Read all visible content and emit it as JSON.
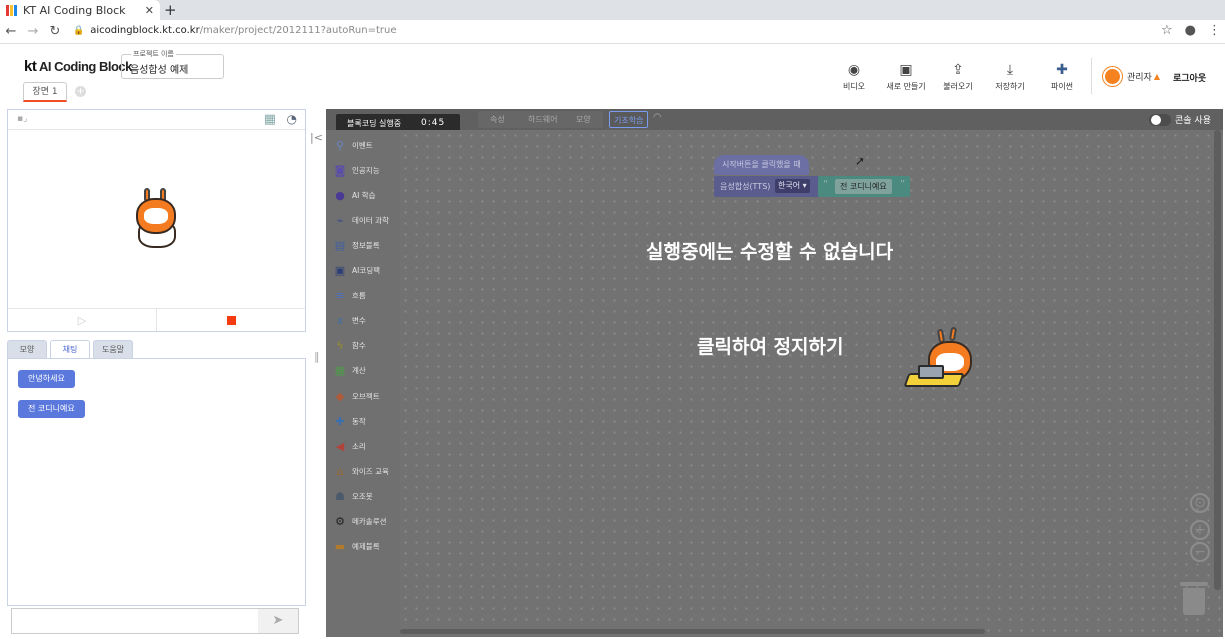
{
  "browser": {
    "tab_title": "KT AI Coding Block",
    "url_host": "aicodingblock.kt.co.kr",
    "url_path": "/maker/project/2012111?autoRun=true"
  },
  "header": {
    "logo_kt": "kt",
    "logo_text": "AI Coding Block",
    "project_label": "프로젝트 이름",
    "project_name": "음성합성 예제",
    "scene_tab": "장면 1",
    "tools": [
      {
        "label": "비디오",
        "icon": "webcam-icon"
      },
      {
        "label": "새로 만들기",
        "icon": "new-file-icon"
      },
      {
        "label": "불러오기",
        "icon": "upload-icon"
      },
      {
        "label": "저장하기",
        "icon": "download-icon"
      },
      {
        "label": "파이썬",
        "icon": "python-icon"
      }
    ],
    "user_name": "관리자",
    "logout": "로그아웃"
  },
  "left": {
    "tabs": [
      "모양",
      "채팅",
      "도움말"
    ],
    "active_tab": "채팅",
    "chat_messages": [
      "안녕하세요",
      "전 코디니예요"
    ]
  },
  "editor": {
    "tabs": [
      "속성",
      "하드웨어",
      "모양"
    ],
    "basic_tab": "기초학습",
    "run_label": "블록코딩 실행중",
    "timer": "0:45",
    "toggle_label": "콘솔 사용",
    "palette": [
      {
        "label": "이벤트",
        "icon": "event-icon",
        "color": "#6a85c8"
      },
      {
        "label": "인공지능",
        "icon": "ai-robot-icon",
        "color": "#5b4ea8"
      },
      {
        "label": "AI 학습",
        "icon": "ai-learning-icon",
        "color": "#4a3a96"
      },
      {
        "label": "데이터 과학",
        "icon": "chart-icon",
        "color": "#3c4d8f"
      },
      {
        "label": "정보블록",
        "icon": "info-block-icon",
        "color": "#3f5fa0"
      },
      {
        "label": "AI코딩팩",
        "icon": "coding-pack-icon",
        "color": "#2c3e75"
      },
      {
        "label": "흐름",
        "icon": "flow-icon",
        "color": "#4a6fc1"
      },
      {
        "label": "변수",
        "icon": "variable-icon",
        "color": "#3b6fb0"
      },
      {
        "label": "함수",
        "icon": "function-icon",
        "color": "#9b8e2a"
      },
      {
        "label": "계산",
        "icon": "calculate-icon",
        "color": "#4e9a4a"
      },
      {
        "label": "오브젝트",
        "icon": "object-icon",
        "color": "#b05a3a"
      },
      {
        "label": "동작",
        "icon": "move-icon",
        "color": "#3b6fb0"
      },
      {
        "label": "소리",
        "icon": "sound-icon",
        "color": "#b0443a"
      },
      {
        "label": "와이즈 교육",
        "icon": "wise-icon",
        "color": "#9b6a2a"
      },
      {
        "label": "오조봇",
        "icon": "ozobot-icon",
        "color": "#4a5a6a"
      },
      {
        "label": "메카솔루션",
        "icon": "gear-icon",
        "color": "#222222"
      },
      {
        "label": "예제블록",
        "icon": "example-icon",
        "color": "#b07a2a"
      }
    ],
    "block_event": "시작버튼을 클릭했을 때",
    "block_tts": "음성합성(TTS)",
    "block_lang": "한국어",
    "block_text": "전 코디니예요",
    "overlay_msg": "실행중에는 수정할 수 없습니다",
    "overlay_action": "클릭하여 정지하기"
  }
}
